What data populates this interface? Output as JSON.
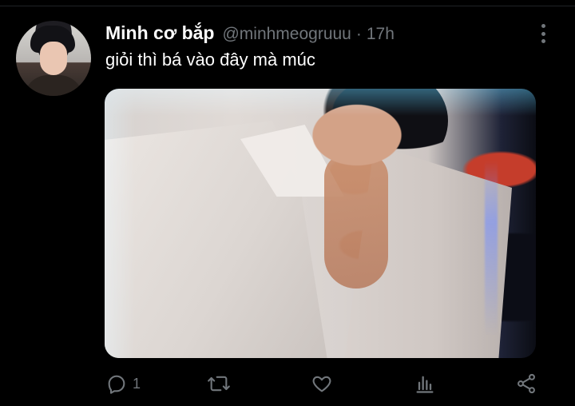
{
  "tweet": {
    "display_name": "Minh cơ bắp",
    "handle": "@minhmeogruuu",
    "separator": "·",
    "time": "17h",
    "text": "giỏi thì bá vào đây mà múc"
  },
  "actions": {
    "reply_count": "1"
  },
  "icons": {
    "more": "more-vertical-icon",
    "reply": "reply-icon",
    "retweet": "retweet-icon",
    "like": "heart-icon",
    "analytics": "analytics-icon",
    "share": "share-icon"
  },
  "colors": {
    "background": "#000000",
    "name": "#ffffff",
    "secondary": "#71767b"
  }
}
